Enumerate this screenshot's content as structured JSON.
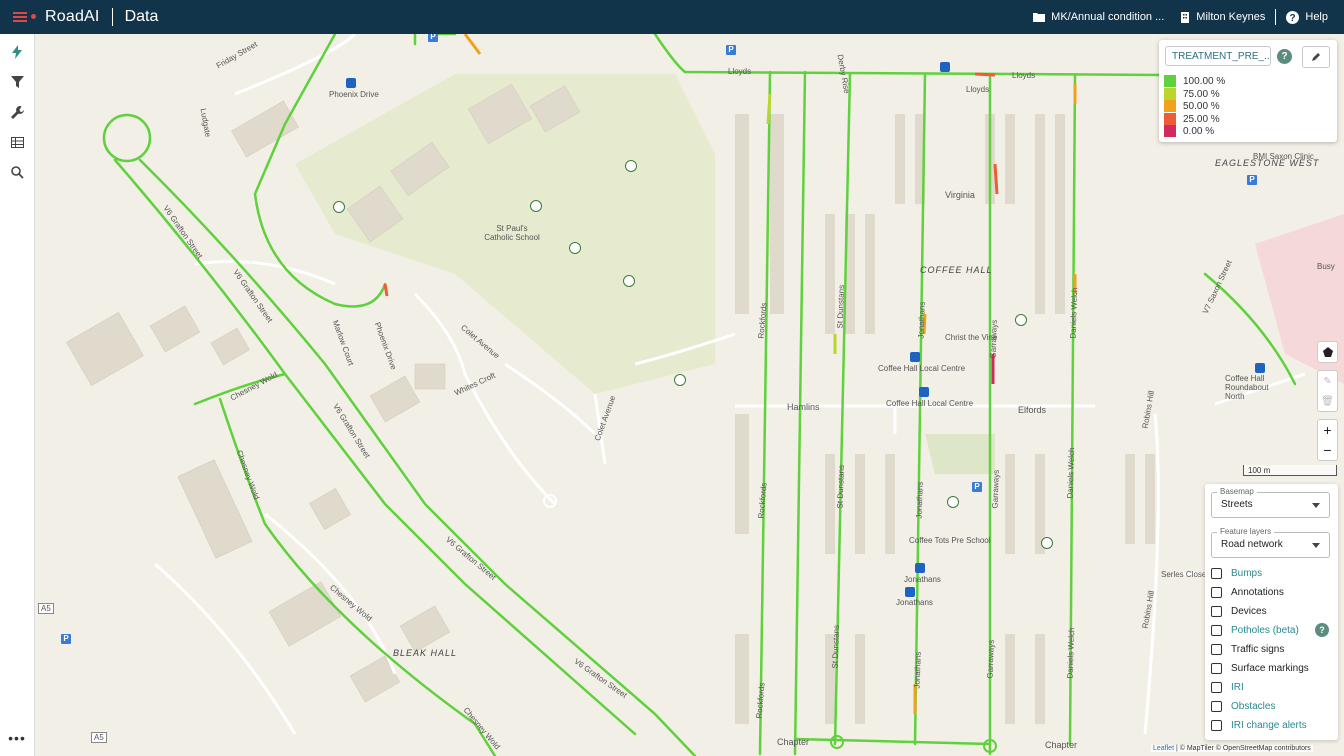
{
  "header": {
    "app_name": "RoadAI",
    "page_name": "Data",
    "project_label": "MK/Annual condition ...",
    "organization_label": "Milton Keynes",
    "help_label": "Help"
  },
  "sidebar": {
    "items": [
      "lightning-icon",
      "filter-icon",
      "wrench-icon",
      "table-icon",
      "search-icon"
    ],
    "more_label": "•••"
  },
  "legend": {
    "layer_name": "TREATMENT_PRE_...",
    "help_label": "?",
    "entries": [
      {
        "label": "100.00 %",
        "color": "#5fd13c"
      },
      {
        "label": "75.00 %",
        "color": "#b8d62b"
      },
      {
        "label": "50.00 %",
        "color": "#f0a21c"
      },
      {
        "label": "25.00 %",
        "color": "#ee5b37"
      },
      {
        "label": "0.00 %",
        "color": "#d12a5e"
      }
    ]
  },
  "map_controls": {
    "zoom_in": "+",
    "zoom_out": "−",
    "scale_label": "100 m"
  },
  "panel": {
    "basemap_label": "Basemap",
    "basemap_value": "Streets",
    "feature_layers_label": "Feature layers",
    "feature_layers_value": "Road network",
    "layers": [
      {
        "label": "Bumps",
        "link": true
      },
      {
        "label": "Annotations",
        "link": false
      },
      {
        "label": "Devices",
        "link": false
      },
      {
        "label": "Potholes (beta)",
        "link": true
      },
      {
        "label": "Traffic signs",
        "link": false
      },
      {
        "label": "Surface markings",
        "link": false
      },
      {
        "label": "IRI",
        "link": true
      },
      {
        "label": "Obstacles",
        "link": true
      },
      {
        "label": "IRI change alerts",
        "link": true
      }
    ],
    "potholes_help": "?"
  },
  "attribution": {
    "leaflet": "Leaflet",
    "rest": " | © MapTiler © OpenStreetMap contributors"
  },
  "map_labels": {
    "friday_street": "Friday Street",
    "phoenix_drive": "Phoenix Drive",
    "ludgate": "Ludgate",
    "st_pauls": "St Paul's Catholic School",
    "v6_grafton_street": "V6 Grafton Street",
    "marlow_court": "Marlow Court",
    "phoenix_drive_2": "Phoenix Drive",
    "colet_avenue": "Colet Avenue",
    "whites_croft": "Whites Croft",
    "colet_avenue_2": "Colet Avenue",
    "chesney_wold": "Chesney Wold",
    "bleak_hall": "BLEAK HALL",
    "hamlins": "Hamlins",
    "elfords": "Elfords",
    "coffee_hall": "COFFEE HALL",
    "virginia": "Virginia",
    "eaglestone_west": "EAGLESTONE WEST",
    "bmi_saxon_clinic": "BMI Saxon Clinic",
    "lloyds": "Lloyds",
    "coffee_hall_local_centre": "Coffee Hall Local Centre",
    "christ_the_vine": "Christ the Vine",
    "coffee_tots": "Coffee Tots Pre School",
    "jonathans": "Jonathans",
    "chapter": "Chapter",
    "serles_close": "Serles Close",
    "robins_hill": "Robins Hill",
    "v7_saxon_street": "V7 Saxon Street",
    "coffee_hall_roundabout": "Coffee Hall Roundabout North",
    "a5": "A5",
    "busy": "Busy",
    "rockfords": "Rockfords",
    "st_dunstans": "St Dunstans",
    "garraways": "Garraways",
    "daniels_welch": "Daniels Welch",
    "derby_rise": "Derby Rise"
  }
}
